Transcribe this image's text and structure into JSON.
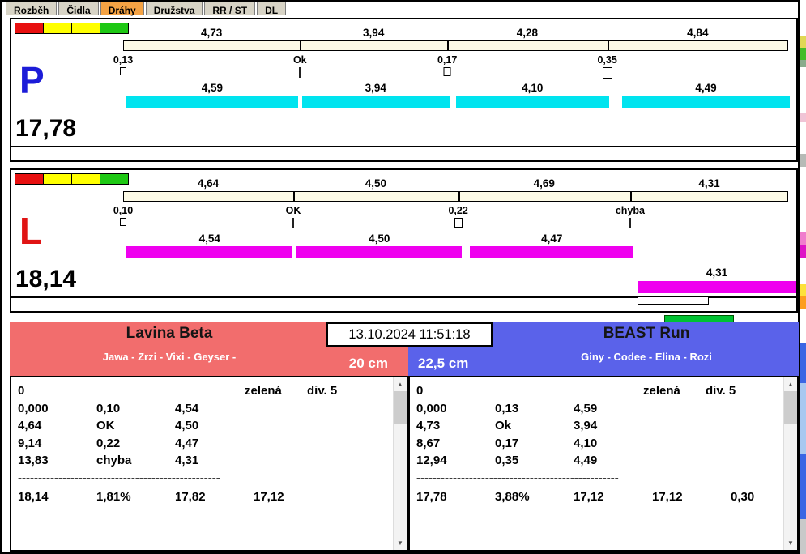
{
  "window": {
    "tabs": [
      "Rozběh",
      "Čidla",
      "Dráhy",
      "Družstva",
      "RR / ST",
      "DL"
    ],
    "active_tab": "Dráhy"
  },
  "clock": "13.10.2024 11:51:18",
  "indicator_color": "#00c232",
  "lanes": [
    {
      "letter": "P",
      "letter_color": "#1c1cd8",
      "total": "17,78",
      "bar_color": "#00e4ef",
      "lights": [
        "#e81010",
        "#ffff00",
        "#ffff00",
        "#1ec814"
      ],
      "plan": [
        {
          "t": "4,73",
          "v": 4.73
        },
        {
          "t": "3,94",
          "v": 3.94
        },
        {
          "t": "4,28",
          "v": 4.28
        },
        {
          "t": "4,84",
          "v": 4.84
        }
      ],
      "marks": [
        {
          "t": "0,13",
          "v": 0.13
        },
        {
          "t": "Ok"
        },
        {
          "t": "0,17",
          "v": 0.17
        },
        {
          "t": "0,35",
          "v": 0.35
        }
      ],
      "runs": [
        {
          "t": "4,59",
          "v": 4.59
        },
        {
          "t": "3,94",
          "v": 3.94
        },
        {
          "t": "4,10",
          "v": 4.1
        },
        {
          "t": "4,49",
          "v": 4.49
        }
      ]
    },
    {
      "letter": "L",
      "letter_color": "#e01414",
      "total": "18,14",
      "bar_color": "#ef00ef",
      "lights": [
        "#e81010",
        "#ffff00",
        "#ffff00",
        "#1ec814"
      ],
      "plan": [
        {
          "t": "4,64",
          "v": 4.64
        },
        {
          "t": "4,50",
          "v": 4.5
        },
        {
          "t": "4,69",
          "v": 4.69
        },
        {
          "t": "4,31",
          "v": 4.31
        }
      ],
      "marks": [
        {
          "t": "0,10",
          "v": 0.1
        },
        {
          "t": "OK"
        },
        {
          "t": "0,22",
          "v": 0.22
        },
        {
          "t": "chyba"
        }
      ],
      "runs": [
        {
          "t": "4,54",
          "v": 4.54
        },
        {
          "t": "4,50",
          "v": 4.5
        },
        {
          "t": "4,47",
          "v": 4.47
        }
      ],
      "extra_run": {
        "t": "4,31",
        "v": 4.31
      }
    }
  ],
  "teams": [
    {
      "name": "Lavina Beta",
      "members": "Jawa - Zrzi - Vixi - Geyser -",
      "category": "20 cm",
      "color": "#f26d6d",
      "rows": [
        [
          "0",
          "",
          "",
          "zelená",
          "div. 5"
        ],
        [
          "0,000",
          "0,10",
          "4,54",
          "",
          ""
        ],
        [
          "4,64",
          "OK",
          "4,50",
          "",
          ""
        ],
        [
          "9,14",
          "0,22",
          "4,47",
          "",
          ""
        ],
        [
          "13,83",
          "chyba",
          "4,31",
          "",
          ""
        ]
      ],
      "separator": "--------------------------------------------------",
      "totals": [
        "18,14",
        "1,81%",
        "17,82",
        "17,12",
        ""
      ]
    },
    {
      "name": "BEAST Run",
      "members": "Giny - Codee - Elina - Rozi",
      "category": "22,5 cm",
      "color": "#5a62ea",
      "rows": [
        [
          "0",
          "",
          "",
          "zelená",
          "div. 5"
        ],
        [
          "0,000",
          "0,13",
          "4,59",
          "",
          ""
        ],
        [
          "4,73",
          "Ok",
          "3,94",
          "",
          ""
        ],
        [
          "8,67",
          "0,17",
          "4,10",
          "",
          ""
        ],
        [
          "12,94",
          "0,35",
          "4,49",
          "",
          ""
        ]
      ],
      "separator": "--------------------------------------------------",
      "totals": [
        "17,78",
        "3,88%",
        "17,12",
        "17,12",
        "0,30"
      ]
    }
  ],
  "scrollbar": {
    "up": "▲",
    "down": "▼"
  }
}
